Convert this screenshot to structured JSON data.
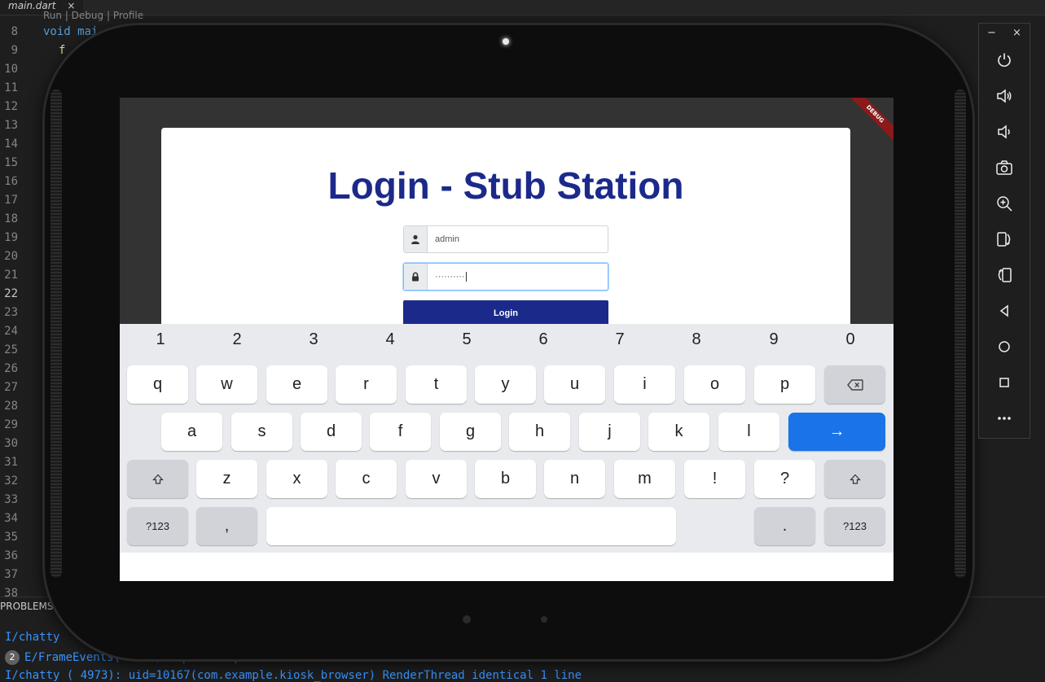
{
  "ide": {
    "file_tab": "main.dart",
    "codelens": "Run | Debug | Profile",
    "line_numbers": [
      "8",
      "9",
      "10",
      "11",
      "12",
      "13",
      "14",
      "15",
      "16",
      "17",
      "18",
      "19",
      "20",
      "21",
      "22",
      "23",
      "24",
      "25",
      "26",
      "27",
      "28",
      "29",
      "30",
      "31",
      "32",
      "33",
      "34",
      "35",
      "36",
      "37",
      "38"
    ],
    "active_line": "22",
    "code_visible": "void mai",
    "code_visible_2": "f",
    "problems_label": "PROBLEMS",
    "console": {
      "line1": "I/chatty",
      "line2_badge": "2",
      "line2": "E/FrameEvents( 4973): updateAcquireFence: Did not find frame.",
      "line3": "I/chatty  ( 4973): uid=10167(com.example.kiosk_browser) RenderThread identical 1 line"
    }
  },
  "app": {
    "debug_banner": "DEBUG",
    "title": "Login - Stub Station",
    "username_value": "admin",
    "password_value": "··········",
    "login_button": "Login"
  },
  "keyboard": {
    "numbers": [
      "1",
      "2",
      "3",
      "4",
      "5",
      "6",
      "7",
      "8",
      "9",
      "0"
    ],
    "row1": [
      "q",
      "w",
      "e",
      "r",
      "t",
      "y",
      "u",
      "i",
      "o",
      "p"
    ],
    "row2": [
      "a",
      "s",
      "d",
      "f",
      "g",
      "h",
      "j",
      "k",
      "l"
    ],
    "row3": [
      "z",
      "x",
      "c",
      "v",
      "b",
      "n",
      "m",
      "!",
      "?"
    ],
    "enter_symbol": "→",
    "symbols_label": "?123",
    "comma": ",",
    "period": "."
  },
  "colors": {
    "title_blue": "#1b2a8a",
    "enter_blue": "#1a73e8",
    "debug_red": "#8b1a1a"
  },
  "side_panel": {
    "minimize": "−",
    "close": "×",
    "buttons": [
      "power-icon",
      "volume-up-icon",
      "volume-down-icon",
      "camera-icon",
      "zoom-icon",
      "rotate-left-icon",
      "rotate-right-icon",
      "back-icon",
      "home-icon",
      "overview-icon",
      "more-icon"
    ]
  }
}
